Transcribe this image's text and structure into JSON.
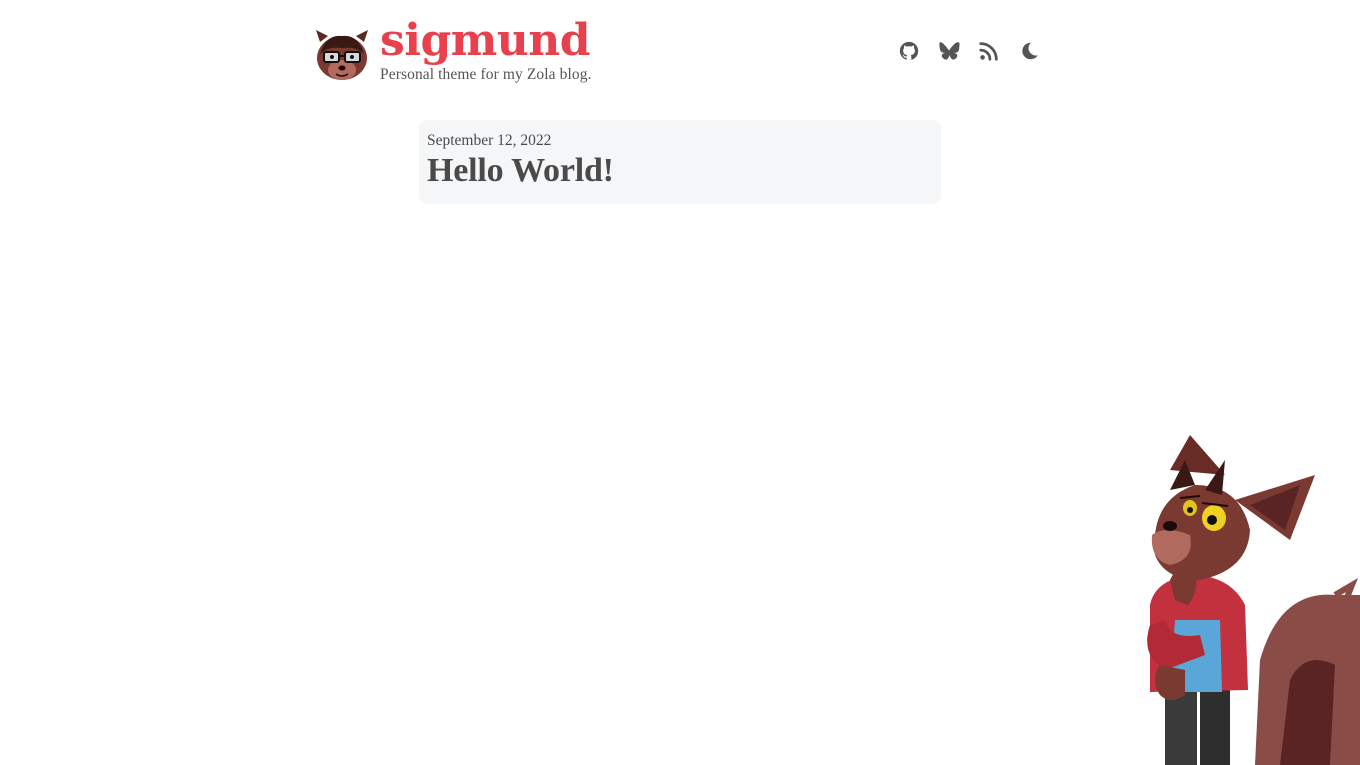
{
  "site": {
    "title": "sigmund",
    "description": "Personal theme for my Zola blog.",
    "accent_color": "#e8404c",
    "avatar_icon": "fox-avatar"
  },
  "nav": {
    "items": [
      {
        "icon": "github-icon"
      },
      {
        "icon": "bluesky-butterfly-icon"
      },
      {
        "icon": "rss-icon"
      },
      {
        "icon": "moon-theme-toggle-icon"
      }
    ]
  },
  "posts": [
    {
      "date": "September 12, 2022",
      "title": "Hello World!"
    }
  ],
  "colors": {
    "card_background": "#f5f6f8",
    "text": "#4a4a4a",
    "icon": "#555555"
  }
}
